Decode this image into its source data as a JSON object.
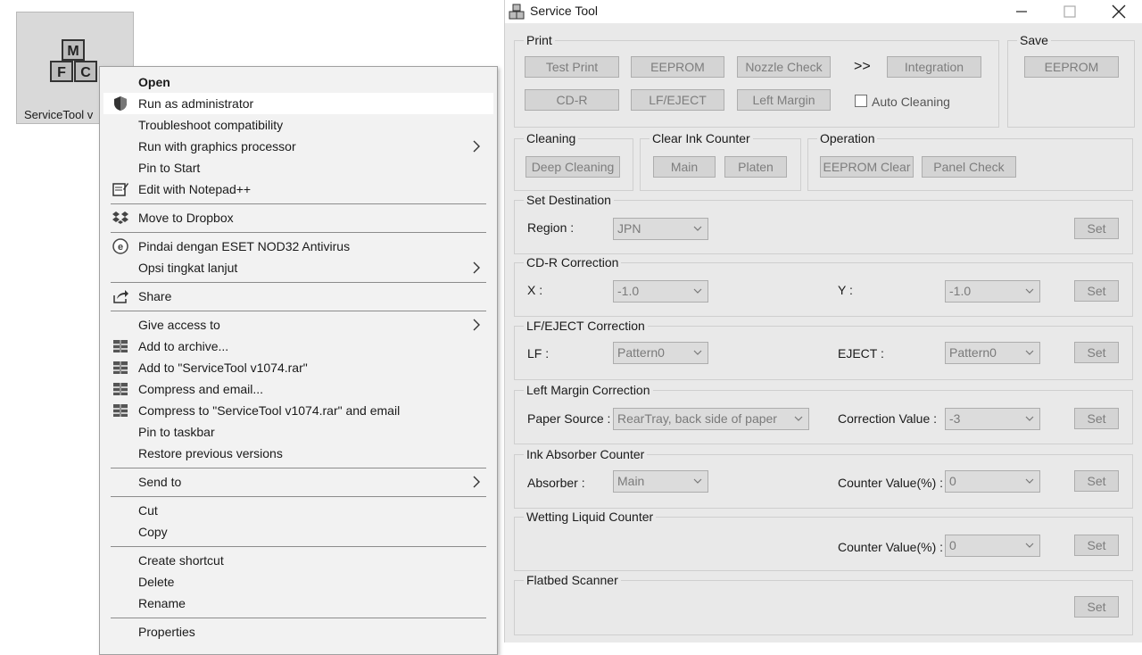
{
  "desktop": {
    "icon_caption": "ServiceTool v",
    "icon_letters": [
      "M",
      "F",
      "C"
    ]
  },
  "context_menu": {
    "items": [
      {
        "label": "Open"
      },
      {
        "label": "Run as administrator",
        "icon": "shield-icon"
      },
      {
        "label": "Troubleshoot compatibility"
      },
      {
        "label": "Run with graphics processor",
        "submenu": true
      },
      {
        "label": "Pin to Start"
      },
      {
        "label": "Edit with Notepad++",
        "icon": "notepad-icon"
      },
      {
        "label": "Move to Dropbox",
        "icon": "dropbox-icon"
      },
      {
        "label": "Pindai dengan ESET NOD32 Antivirus",
        "icon": "eset-icon"
      },
      {
        "label": "Opsi tingkat lanjut",
        "submenu": true
      },
      {
        "label": "Share",
        "icon": "share-icon"
      },
      {
        "label": "Give access to",
        "submenu": true
      },
      {
        "label": "Add to archive...",
        "icon": "winrar-icon"
      },
      {
        "label": "Add to \"ServiceTool v1074.rar\"",
        "icon": "winrar-icon"
      },
      {
        "label": "Compress and email...",
        "icon": "winrar-icon"
      },
      {
        "label": "Compress to \"ServiceTool v1074.rar\" and email",
        "icon": "winrar-icon"
      },
      {
        "label": "Pin to taskbar"
      },
      {
        "label": "Restore previous versions"
      },
      {
        "label": "Send to",
        "submenu": true
      },
      {
        "label": "Cut"
      },
      {
        "label": "Copy"
      },
      {
        "label": "Create shortcut"
      },
      {
        "label": "Delete"
      },
      {
        "label": "Rename"
      },
      {
        "label": "Properties"
      }
    ]
  },
  "window": {
    "title": "Service Tool",
    "print": {
      "title": "Print",
      "test_print": "Test Print",
      "eeprom": "EEPROM",
      "nozzle_check": "Nozzle Check",
      "more": ">>",
      "integration": "Integration",
      "cdr": "CD-R",
      "lf_eject": "LF/EJECT",
      "left_margin": "Left Margin",
      "auto_cleaning": "Auto Cleaning"
    },
    "save": {
      "title": "Save",
      "eeprom": "EEPROM"
    },
    "cleaning": {
      "title": "Cleaning",
      "deep_cleaning": "Deep Cleaning"
    },
    "clear_ink_counter": {
      "title": "Clear Ink Counter",
      "main": "Main",
      "platen": "Platen"
    },
    "operation": {
      "title": "Operation",
      "eeprom_clear": "EEPROM Clear",
      "panel_check": "Panel Check"
    },
    "set_destination": {
      "title": "Set Destination",
      "region_label": "Region :",
      "region_value": "JPN",
      "set": "Set"
    },
    "cdr_correction": {
      "title": "CD-R Correction",
      "x_label": "X :",
      "x_value": "-1.0",
      "y_label": "Y :",
      "y_value": "-1.0",
      "set": "Set"
    },
    "lf_eject_correction": {
      "title": "LF/EJECT Correction",
      "lf_label": "LF :",
      "lf_value": "Pattern0",
      "eject_label": "EJECT :",
      "eject_value": "Pattern0",
      "set": "Set"
    },
    "left_margin_correction": {
      "title": "Left Margin Correction",
      "paper_source_label": "Paper Source :",
      "paper_source_value": "RearTray, back side of paper",
      "correction_label": "Correction Value :",
      "correction_value": "-3",
      "set": "Set"
    },
    "ink_absorber_counter": {
      "title": "Ink Absorber Counter",
      "absorber_label": "Absorber :",
      "absorber_value": "Main",
      "counter_label": "Counter Value(%) :",
      "counter_value": "0",
      "set": "Set"
    },
    "wetting_liquid_counter": {
      "title": "Wetting Liquid Counter",
      "counter_label": "Counter Value(%) :",
      "counter_value": "0",
      "set": "Set"
    },
    "flatbed_scanner": {
      "title": "Flatbed Scanner",
      "set": "Set"
    }
  }
}
